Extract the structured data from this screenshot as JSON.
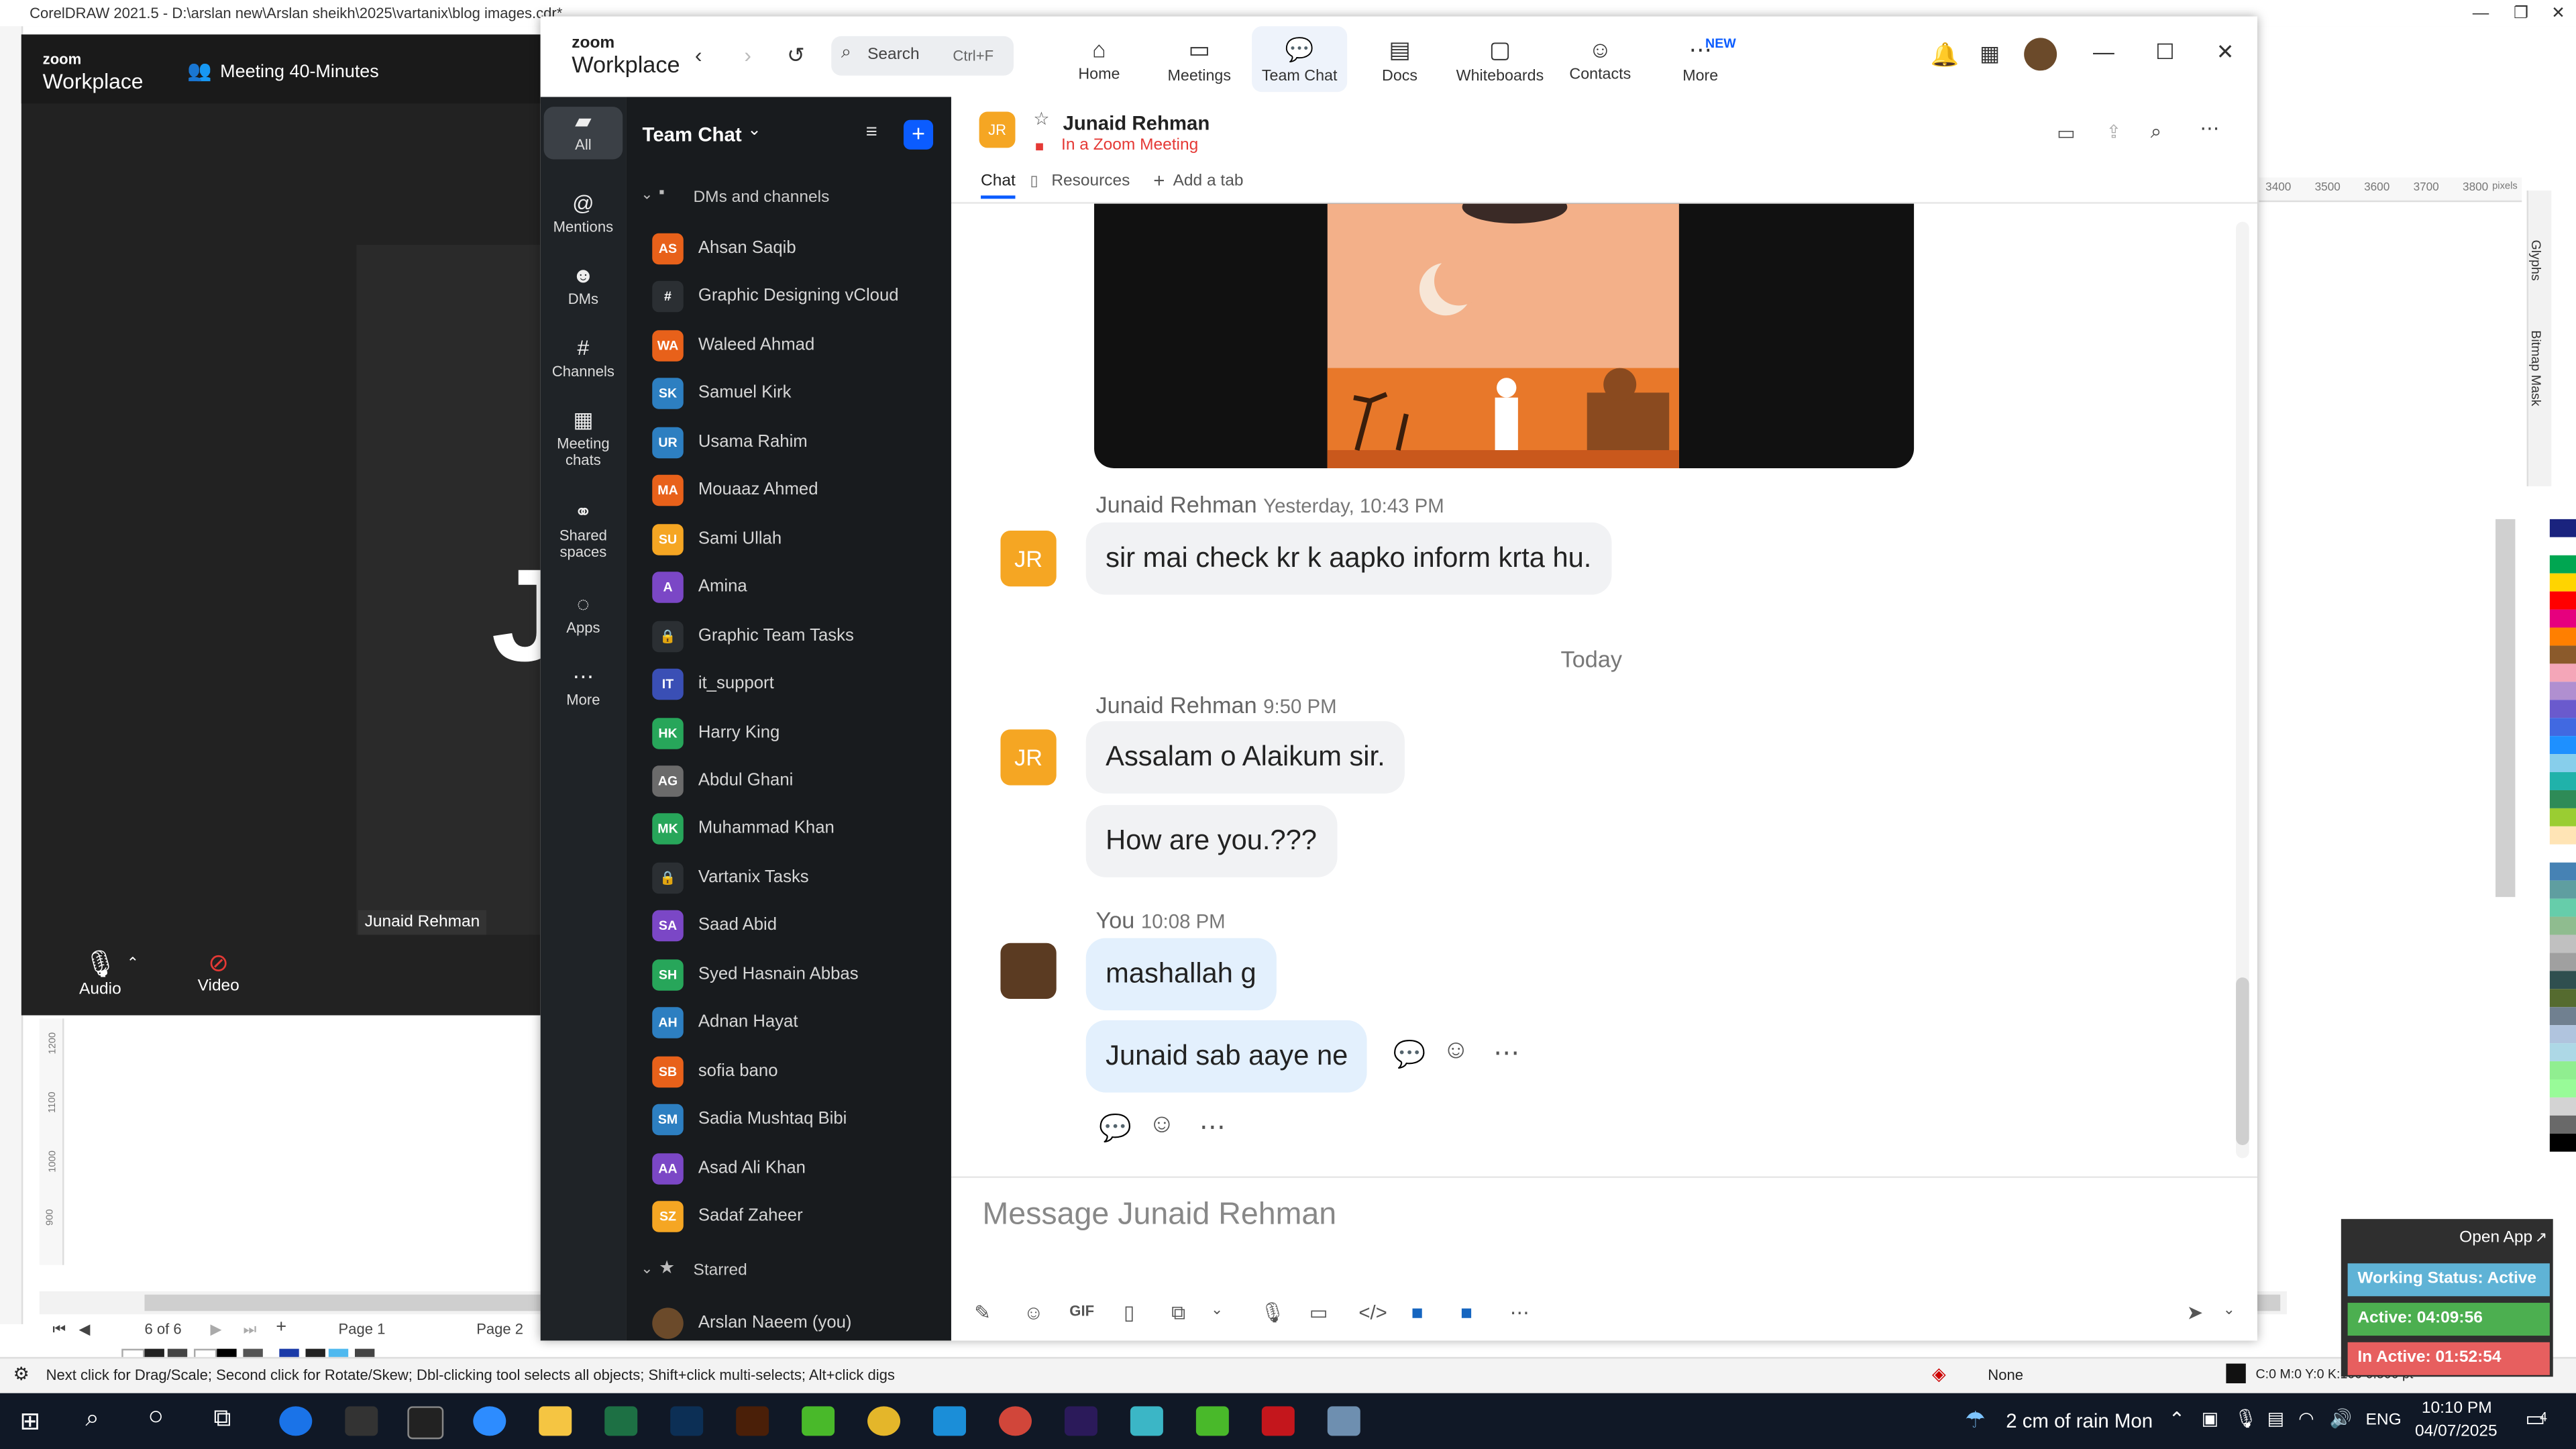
{
  "corel": {
    "title": "CorelDRAW 2021.5 - D:\\arslan new\\Arslan sheikh\\2025\\vartanix\\blog images.cdr*",
    "status_hint": "Next click for Drag/Scale; Second click for Rotate/Skew; Dbl-clicking tool selects all objects; Shift+click multi-selects; Alt+click digs",
    "fill_none": "None",
    "color_info": "C:0 M:0 Y:0 K:100  0.500 pt",
    "page_counter": "6 of 6",
    "page1": "Page 1",
    "page2": "Page 2",
    "ruler_top": [
      "3400",
      "3500",
      "3600",
      "3700",
      "3800"
    ],
    "ruler_unit": "pixels",
    "ruler_left": [
      "1200",
      "1100",
      "1000",
      "900"
    ],
    "dock_glyphs": "Glyphs",
    "dock_bitmap": "Bitmap Mask"
  },
  "meeting": {
    "logo_top": "zoom",
    "logo_bottom": "Workplace",
    "title": "Meeting 40-Minutes",
    "initial": "J",
    "participant": "Junaid Rehman",
    "audio": "Audio",
    "video": "Video"
  },
  "zoom": {
    "logo_top": "zoom",
    "logo_bottom": "Workplace",
    "search_placeholder": "Search",
    "search_shortcut": "Ctrl+F",
    "nav": [
      {
        "label": "Home",
        "icon": "home-icon"
      },
      {
        "label": "Meetings",
        "icon": "video-camera-icon"
      },
      {
        "label": "Team Chat",
        "icon": "chat-icon"
      },
      {
        "label": "Docs",
        "icon": "doc-icon"
      },
      {
        "label": "Whiteboards",
        "icon": "whiteboard-icon"
      },
      {
        "label": "Contacts",
        "icon": "contacts-icon"
      },
      {
        "label": "More",
        "icon": "more-icon"
      }
    ],
    "more_badge": "NEW",
    "rail": [
      {
        "label": "All"
      },
      {
        "label": "Mentions"
      },
      {
        "label": "DMs"
      },
      {
        "label": "Channels"
      },
      {
        "label": "Meeting chats"
      },
      {
        "label": "Shared spaces"
      },
      {
        "label": "Apps"
      },
      {
        "label": "More"
      }
    ],
    "list_title": "Team Chat",
    "section_dms": "DMs and channels",
    "section_starred": "Starred",
    "contacts": [
      {
        "initials": "AS",
        "name": "Ahsan Saqib",
        "color": "#e8611a"
      },
      {
        "initials": "#",
        "name": "Graphic Designing vCloud",
        "color": "#2b2f33"
      },
      {
        "initials": "WA",
        "name": "Waleed Ahmad",
        "color": "#e8611a"
      },
      {
        "initials": "SK",
        "name": "Samuel Kirk",
        "color": "#2d7fc1"
      },
      {
        "initials": "UR",
        "name": "Usama Rahim",
        "color": "#2d7fc1"
      },
      {
        "initials": "MA",
        "name": "Mouaaz Ahmed",
        "color": "#e8611a"
      },
      {
        "initials": "SU",
        "name": "Sami Ullah",
        "color": "#f5a623"
      },
      {
        "initials": "A",
        "name": "Amina",
        "color": "#7b47c6"
      },
      {
        "initials": "🔒",
        "name": "Graphic Team Tasks",
        "color": "#2b2f33"
      },
      {
        "initials": "IT",
        "name": "it_support",
        "color": "#3a4fb5"
      },
      {
        "initials": "HK",
        "name": "Harry King",
        "color": "#27a65a"
      },
      {
        "initials": "AG",
        "name": "Abdul Ghani",
        "color": "#6b6b6b"
      },
      {
        "initials": "MK",
        "name": "Muhammad Khan",
        "color": "#27a65a"
      },
      {
        "initials": "🔒",
        "name": "Vartanix Tasks",
        "color": "#2b2f33"
      },
      {
        "initials": "SA",
        "name": "Saad Abid",
        "color": "#7b47c6"
      },
      {
        "initials": "SH",
        "name": "Syed Hasnain Abbas",
        "color": "#27a65a"
      },
      {
        "initials": "AH",
        "name": "Adnan Hayat",
        "color": "#2d7fc1"
      },
      {
        "initials": "SB",
        "name": "sofia bano",
        "color": "#e8611a"
      },
      {
        "initials": "SM",
        "name": "Sadia Mushtaq Bibi",
        "color": "#2d7fc1"
      },
      {
        "initials": "AA",
        "name": "Asad Ali Khan",
        "color": "#7b47c6"
      },
      {
        "initials": "SZ",
        "name": "Sadaf Zaheer",
        "color": "#f5a623"
      }
    ],
    "starred_me": "Arslan Naeem (you)",
    "chat": {
      "avatar": "JR",
      "name": "Junaid Rehman",
      "status": "In a Zoom Meeting",
      "tabs": [
        "Chat",
        "Resources",
        "Add a tab"
      ],
      "msg1_sender": "Junaid Rehman",
      "msg1_time": "Yesterday, 10:43 PM",
      "msg1_text": "sir mai check kr k aapko inform krta hu.",
      "divider": "Today",
      "msg2_sender": "Junaid Rehman",
      "msg2_time": "9:50 PM",
      "msg2_a": "Assalam o Alaikum sir.",
      "msg2_b": "How are you.???",
      "msg3_sender": "You",
      "msg3_time": "10:08 PM",
      "msg3_a": "mashallah g",
      "msg3_b": "Junaid sab aaye ne",
      "composer_placeholder": "Message Junaid Rehman",
      "composer_gif": "GIF"
    }
  },
  "widget": {
    "open_app": "Open App",
    "working": "Working Status: Active",
    "active": "Active: 04:09:56",
    "inactive": "In Active: 01:52:54"
  },
  "taskbar": {
    "weather": "2 cm of rain Mon",
    "lang": "ENG",
    "time": "10:10 PM",
    "date": "04/07/2025",
    "notif": "4"
  }
}
